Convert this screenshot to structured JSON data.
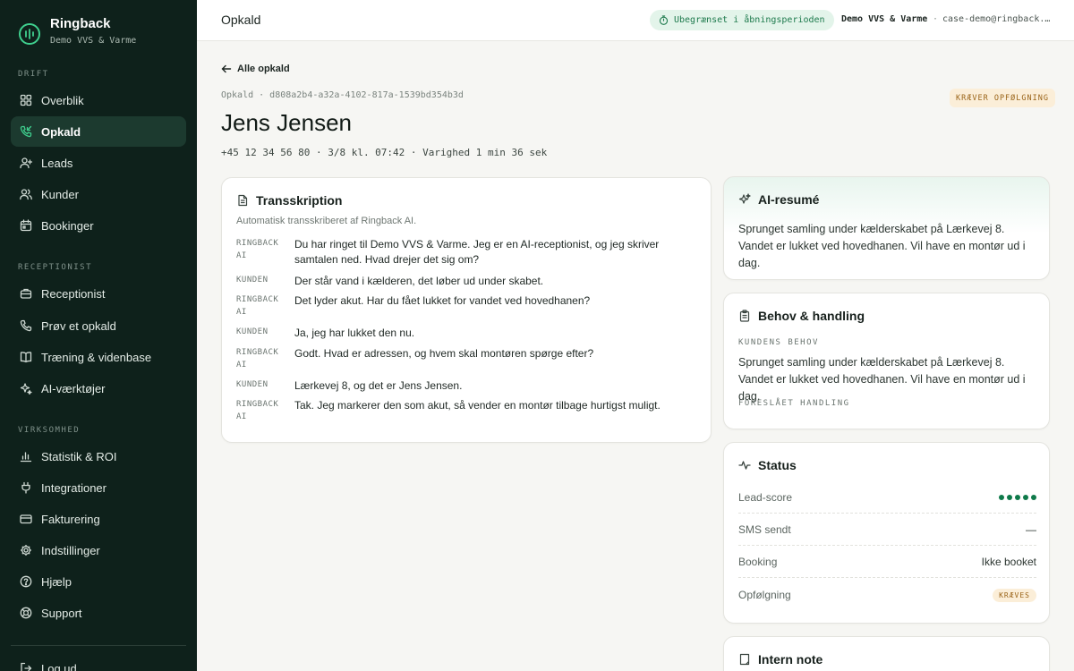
{
  "brand": {
    "name": "Ringback",
    "subtitle": "Demo VVS & Varme"
  },
  "sidebar": {
    "sections": [
      {
        "label": "DRIFT"
      },
      {
        "label": "RECEPTIONIST"
      },
      {
        "label": "VIRKSOMHED"
      }
    ],
    "items": [
      {
        "label": "Overblik",
        "icon": "grid-icon"
      },
      {
        "label": "Opkald",
        "icon": "phone-incoming-icon",
        "active": true
      },
      {
        "label": "Leads",
        "icon": "user-plus-icon"
      },
      {
        "label": "Kunder",
        "icon": "users-icon"
      },
      {
        "label": "Bookinger",
        "icon": "calendar-icon"
      },
      {
        "label": "Receptionist",
        "icon": "briefcase-icon"
      },
      {
        "label": "Prøv et opkald",
        "icon": "phone-icon"
      },
      {
        "label": "Træning & videnbase",
        "icon": "book-icon"
      },
      {
        "label": "AI-værktøjer",
        "icon": "sparkles-icon"
      },
      {
        "label": "Statistik & ROI",
        "icon": "bar-chart-icon"
      },
      {
        "label": "Integrationer",
        "icon": "plug-icon"
      },
      {
        "label": "Fakturering",
        "icon": "credit-card-icon"
      },
      {
        "label": "Indstillinger",
        "icon": "gear-icon"
      },
      {
        "label": "Hjælp",
        "icon": "help-circle-icon"
      },
      {
        "label": "Support",
        "icon": "lifebuoy-icon"
      }
    ],
    "logout_label": "Log ud"
  },
  "header": {
    "title": "Opkald",
    "plan_badge": "Ubegrænset i åbningsperioden",
    "company": "Demo VVS & Varme",
    "separator": "·",
    "email": "case-demo@ringback.dk"
  },
  "call": {
    "back_label": "Alle opkald",
    "meta": "Opkald · d808a2b4-a32a-4102-817a-1539bd354b3d",
    "flag": "KRÆVER OPFØLGNING",
    "caller_name": "Jens Jensen",
    "subline": "+45 12 34 56 80 · 3/8 kl. 07:42 · Varighed 1 min 36 sek"
  },
  "transcript": {
    "title": "Transskription",
    "subtitle": "Automatisk transskriberet af Ringback AI.",
    "turns": [
      {
        "speaker": "RINGBACK AI",
        "text": "Du har ringet til Demo VVS & Varme. Jeg er en AI-receptionist, og jeg skriver samtalen ned. Hvad drejer det sig om?"
      },
      {
        "speaker": "KUNDEN",
        "text": "Der står vand i kælderen, det løber ud under skabet."
      },
      {
        "speaker": "RINGBACK AI",
        "text": "Det lyder akut. Har du fået lukket for vandet ved hovedhanen?"
      },
      {
        "speaker": "KUNDEN",
        "text": "Ja, jeg har lukket den nu."
      },
      {
        "speaker": "RINGBACK AI",
        "text": "Godt. Hvad er adressen, og hvem skal montøren spørge efter?"
      },
      {
        "speaker": "KUNDEN",
        "text": "Lærkevej 8, og det er Jens Jensen."
      },
      {
        "speaker": "RINGBACK AI",
        "text": "Tak. Jeg markerer den som akut, så vender en montør tilbage hurtigst muligt."
      }
    ]
  },
  "summary": {
    "title": "AI-resumé",
    "text": "Sprunget samling under kælderskabet på Lærkevej 8. Vandet er lukket ved hovedhanen. Vil have en montør ud i dag."
  },
  "needs": {
    "title": "Behov & handling",
    "need_label": "KUNDENS BEHOV",
    "need_text": "Sprunget samling under kælderskabet på Lærkevej 8. Vandet er lukket ved hovedhanen. Vil have en montør ud i dag.",
    "action_label": "FORESLÅET HANDLING"
  },
  "status": {
    "title": "Status",
    "rows": [
      {
        "label": "Lead-score",
        "score": 5,
        "score_max": 5
      },
      {
        "label": "SMS sendt",
        "value": "—"
      },
      {
        "label": "Booking",
        "value": "Ikke booket"
      },
      {
        "label": "Opfølgning",
        "value": "KRÆVES"
      }
    ]
  },
  "note": {
    "title": "Intern note"
  },
  "colors": {
    "sidebar_bg": "#0e211b",
    "accent": "#0f7a4a",
    "warning_bg": "#fbeed8",
    "warning_fg": "#9a6418"
  }
}
